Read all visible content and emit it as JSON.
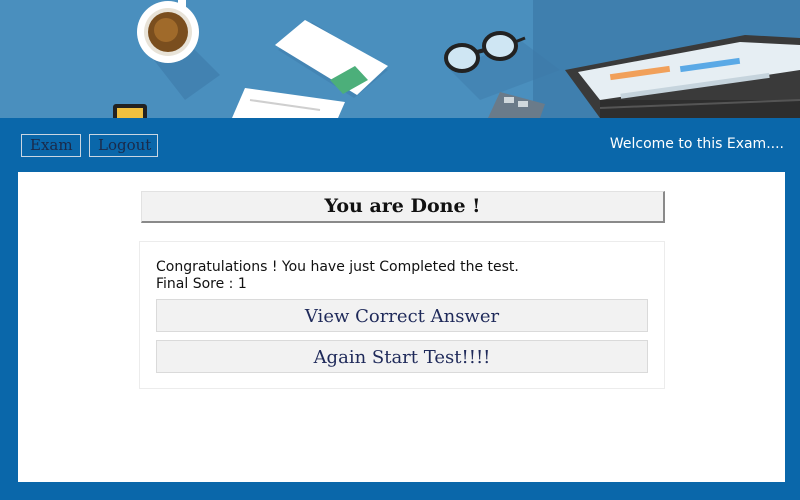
{
  "header": {
    "nav": [
      {
        "label": "Exam"
      },
      {
        "label": "Logout"
      }
    ],
    "welcome": "Welcome to this Exam...."
  },
  "result": {
    "title": "You are Done !",
    "message": "Congratulations ! You have just Completed the test.",
    "final_score": "Final Sore : 1"
  },
  "actions": {
    "view_correct": "View Correct Answer",
    "again_start": "Again Start Test!!!!"
  },
  "colors": {
    "primary": "#0a67aa",
    "banner": "#4a8fbe",
    "button_bg": "#f2f2f2"
  },
  "icons": {
    "banner_items": [
      "coffee-cup-icon",
      "envelope-icon",
      "paper-icon",
      "glasses-icon",
      "calculator-icon",
      "laptop-icon",
      "phone-icon"
    ]
  }
}
